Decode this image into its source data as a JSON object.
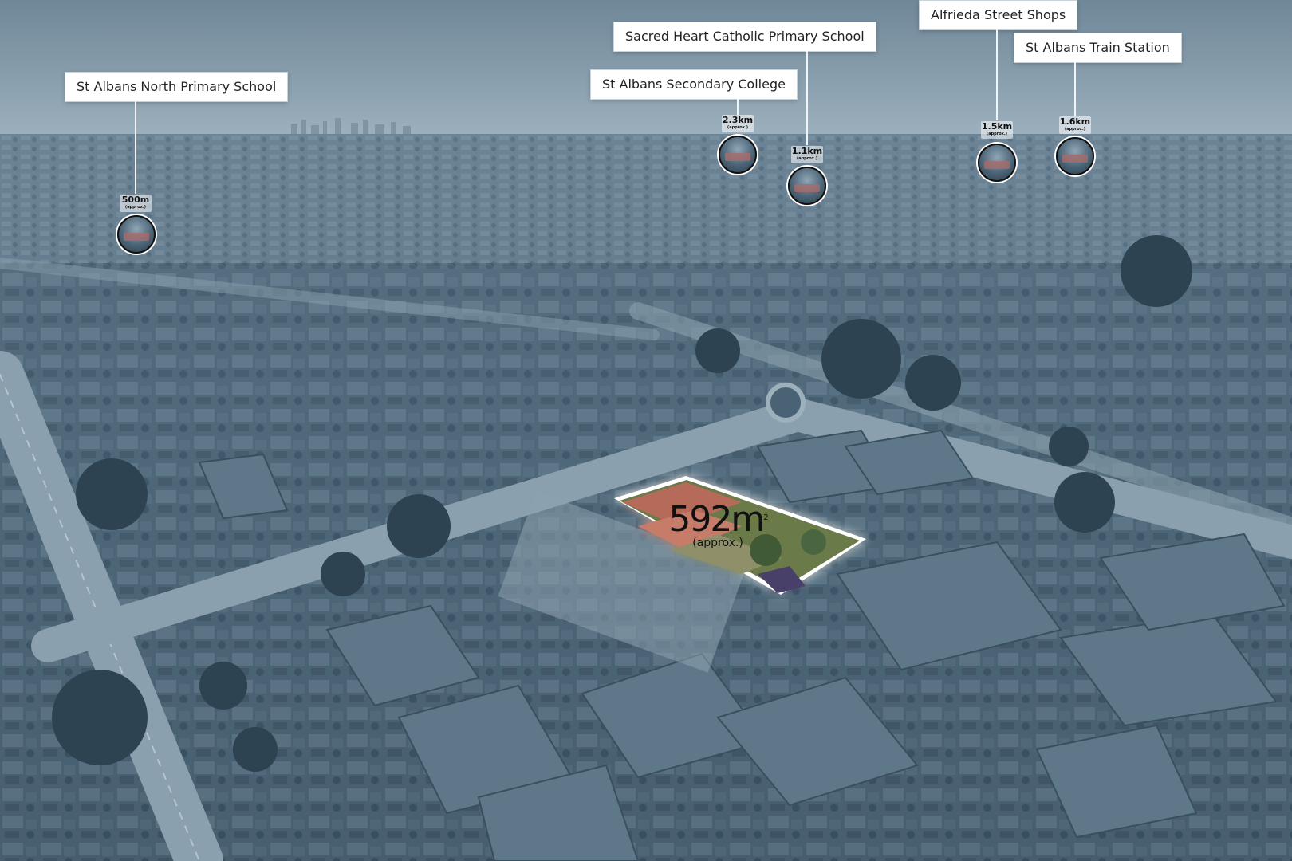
{
  "property": {
    "area_value": "592m",
    "area_superscript": "2",
    "area_qualifier": "(approx.)"
  },
  "points_of_interest": [
    {
      "name": "St Albans North Primary School",
      "distance": "500m",
      "qualifier": "(approx.)"
    },
    {
      "name": "St Albans Secondary College",
      "distance": "2.3km",
      "qualifier": "(approx.)"
    },
    {
      "name": "Sacred Heart Catholic Primary School",
      "distance": "1.1km",
      "qualifier": "(approx.)"
    },
    {
      "name": "Alfrieda Street Shops",
      "distance": "1.5km",
      "qualifier": "(approx.)"
    },
    {
      "name": "St Albans Train Station",
      "distance": "1.6km",
      "qualifier": "(approx.)"
    }
  ],
  "colors": {
    "sky": "#7d95a6",
    "ground": "#4e6677",
    "highlight_lot": "#b56a5a",
    "label_bg": "#ffffff"
  }
}
